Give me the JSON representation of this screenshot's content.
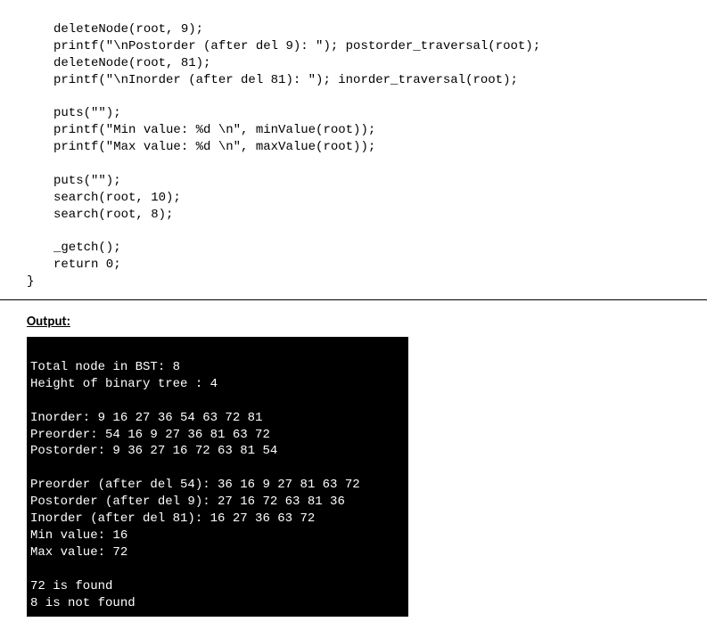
{
  "code": {
    "l1": "deleteNode(root, 9);",
    "l2": "printf(\"\\nPostorder (after del 9): \"); postorder_traversal(root);",
    "l3": "deleteNode(root, 81);",
    "l4": "printf(\"\\nInorder (after del 81): \"); inorder_traversal(root);",
    "l5": "",
    "l6": "puts(\"\");",
    "l7": "printf(\"Min value: %d \\n\", minValue(root));",
    "l8": "printf(\"Max value: %d \\n\", maxValue(root));",
    "l9": "",
    "l10": "puts(\"\");",
    "l11": "search(root, 10);",
    "l12": "search(root, 8);",
    "l13": "",
    "l14": "_getch();",
    "l15": "return 0;",
    "l16": "}"
  },
  "output_label": "Output:",
  "terminal": {
    "t1": "Total node in BST: 8",
    "t2": "Height of binary tree : 4",
    "t3": "",
    "t4": "Inorder: 9 16 27 36 54 63 72 81",
    "t5": "Preorder: 54 16 9 27 36 81 63 72",
    "t6": "Postorder: 9 36 27 16 72 63 81 54",
    "t7": "",
    "t8": "Preorder (after del 54): 36 16 9 27 81 63 72",
    "t9": "Postorder (after del 9): 27 16 72 63 81 36",
    "t10": "Inorder (after del 81): 16 27 36 63 72",
    "t11": "Min value: 16",
    "t12": "Max value: 72",
    "t13": "",
    "t14": "72 is found",
    "t15": "8 is not found"
  }
}
